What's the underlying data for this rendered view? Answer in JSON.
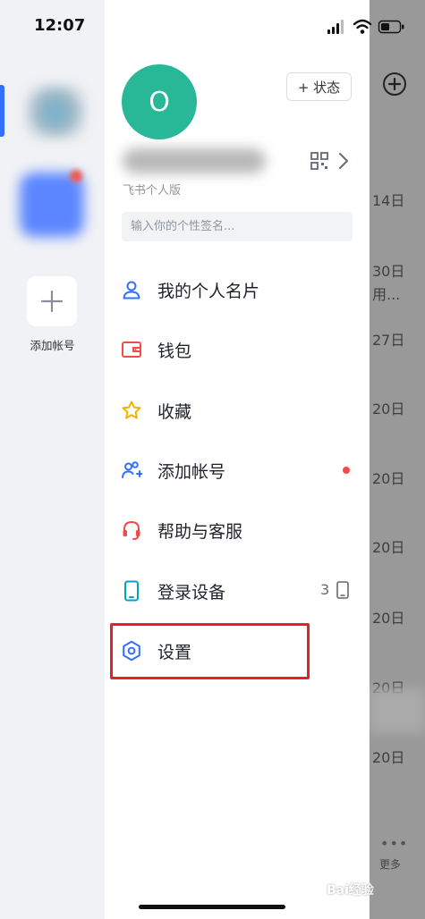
{
  "status_bar": {
    "time": "12:07"
  },
  "rail": {
    "add_account_label": "添加帐号"
  },
  "profile": {
    "avatar_initial": "O",
    "status_button": "+ 状态",
    "edition": "飞书个人版",
    "signature_placeholder": "输入你的个性签名..."
  },
  "menu": {
    "items": [
      {
        "label": "我的个人名片",
        "icon": "person-card-icon"
      },
      {
        "label": "钱包",
        "icon": "wallet-icon"
      },
      {
        "label": "收藏",
        "icon": "star-icon"
      },
      {
        "label": "添加帐号",
        "icon": "add-user-icon"
      },
      {
        "label": "帮助与客服",
        "icon": "headset-icon"
      },
      {
        "label": "登录设备",
        "icon": "phone-icon",
        "count": "3"
      },
      {
        "label": "设置",
        "icon": "gear-icon"
      }
    ]
  },
  "background": {
    "dates": [
      "14日",
      "30日",
      "用...",
      "27日",
      "20日",
      "20日",
      "20日",
      "20日",
      "20日",
      "20日"
    ],
    "more_label": "更多",
    "watermark": "Bai经验"
  },
  "colors": {
    "avatar": "#28b898",
    "accent": "#3370ff",
    "highlight": "#e5202a",
    "notify_dot": "#f54a45"
  }
}
